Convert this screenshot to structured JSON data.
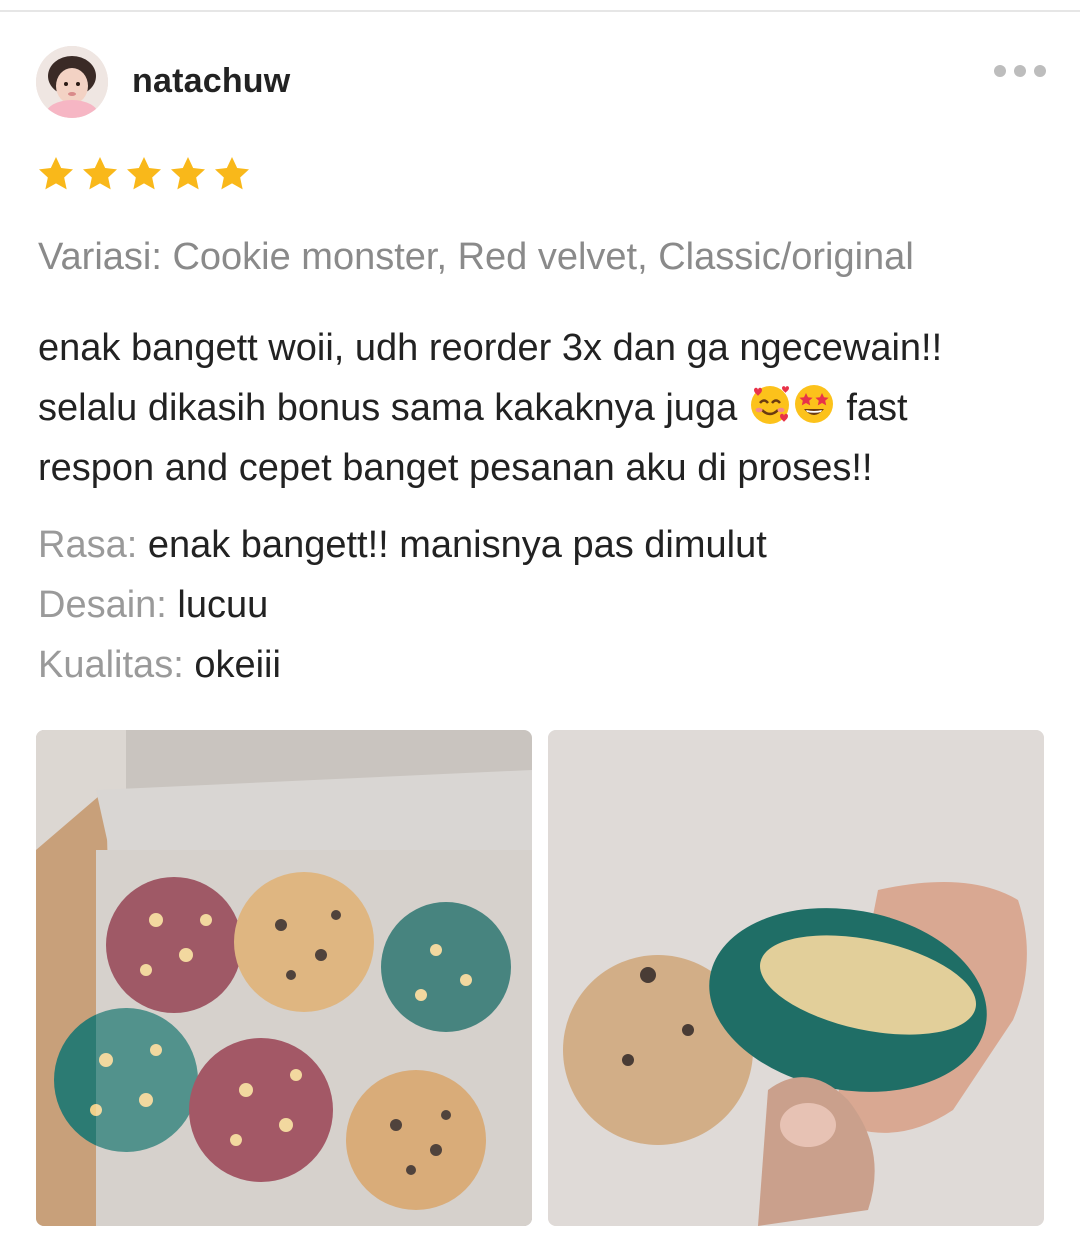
{
  "review": {
    "username": "natachuw",
    "rating": 5,
    "variation": "Variasi: Cookie monster, Red velvet, Classic/original",
    "text_line1": "enak bangett woii, udh reorder 3x dan ga ngecewain!!",
    "text_line2_before": "selalu dikasih bonus sama kakaknya juga ",
    "text_line2_after": " fast",
    "text_line3": "respon and cepet banget pesanan aku di proses!!",
    "emoji_1": "smiling-face-with-hearts-icon",
    "emoji_2": "star-struck-icon",
    "attributes": [
      {
        "label": "Rasa:",
        "value": "enak bangett!! manisnya pas dimulut"
      },
      {
        "label": "Desain:",
        "value": "lucuu"
      },
      {
        "label": "Kualitas:",
        "value": "okeiii"
      }
    ]
  },
  "colors": {
    "star": "#f9b81a",
    "muted_text": "#8a8a8a",
    "text": "#222222"
  }
}
